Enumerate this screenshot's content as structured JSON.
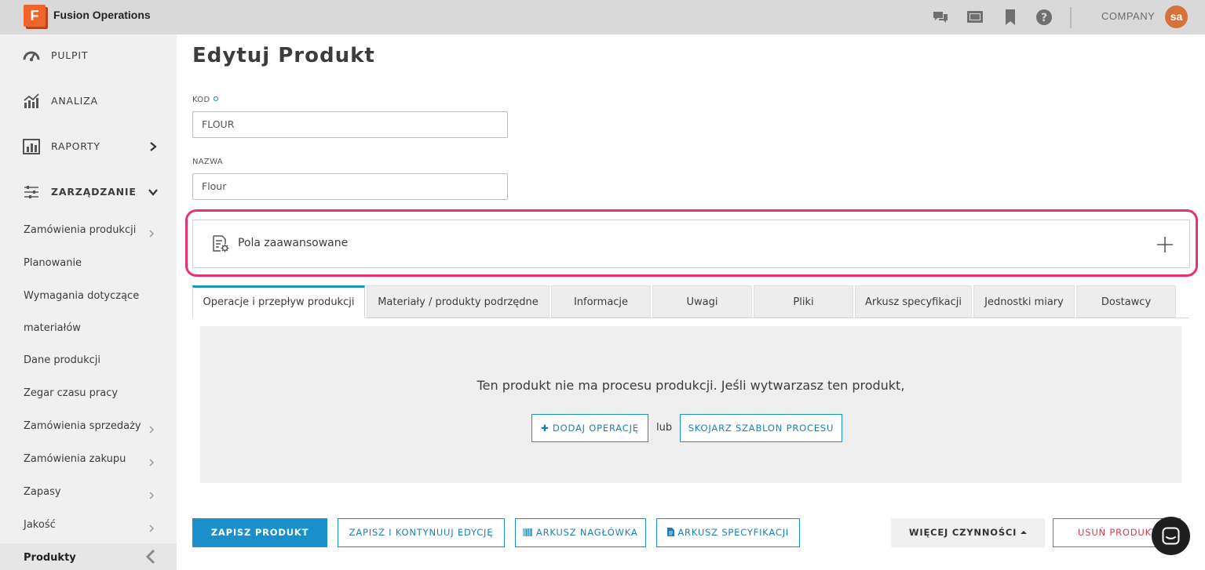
{
  "app": {
    "logo_letter": "F",
    "name": "Fusion Operations"
  },
  "topbar": {
    "icons": [
      "chat-icon",
      "monitor-icon",
      "bookmark-icon",
      "help-icon"
    ],
    "company": "COMPANY",
    "avatar_initials": "sa"
  },
  "sidebar": {
    "main": [
      {
        "label": "PULPIT",
        "icon": "dashboard-gauge-icon"
      },
      {
        "label": "ANALIZA",
        "icon": "analytics-chart-icon"
      },
      {
        "label": "RAPORTY",
        "icon": "reports-icon"
      },
      {
        "label": "ZARZĄDZANIE",
        "icon": "sliders-icon"
      }
    ],
    "sub": [
      "Zamówienia produkcji",
      "Planowanie",
      "Wymagania dotyczące",
      "materiałów",
      "Dane produkcji",
      "Zegar czasu pracy",
      "Zamówienia sprzedaży",
      "Zamówienia zakupu",
      "Zapasy",
      "Jakość",
      "Produkty"
    ]
  },
  "page": {
    "title": "Edytuj Produkt",
    "code_label": "KOD",
    "code_value": "FLOUR",
    "name_label": "NAZWA",
    "name_value": "Flour",
    "advanced_label": "Pola zaawansowane"
  },
  "tabs": [
    "Operacje i przepływ produkcji",
    "Materiały / produkty podrzędne",
    "Informacje",
    "Uwagi",
    "Pliki",
    "Arkusz specyfikacji",
    "Jednostki miary",
    "Dostawcy"
  ],
  "content": {
    "message": "Ten produkt nie ma procesu produkcji. Jeśli wytwarzasz ten produkt,",
    "add_operation": "✚ DODAJ OPERACJĘ",
    "or": "lub",
    "link_template": "SKOJARZ SZABLON PROCESU"
  },
  "actions": {
    "save": "ZAPISZ PRODUKT",
    "save_continue": "ZAPISZ I KONTYNUUJ EDYCJĘ",
    "header_sheet": "ARKUSZ NAGŁÓWKA",
    "spec_sheet": "ARKUSZ SPECYFIKACJI",
    "more_actions": "WIĘCEJ CZYNNOŚCI",
    "delete": "USUŃ PRODUKT"
  },
  "colors": {
    "accent": "#1a8fc9",
    "brand": "#f1642c",
    "highlight": "#e8336a",
    "danger": "#d03a4e"
  }
}
